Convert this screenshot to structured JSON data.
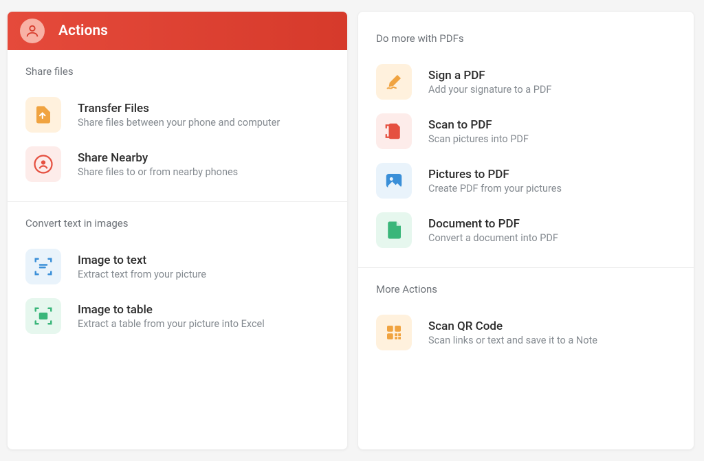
{
  "header": {
    "title": "Actions"
  },
  "left": {
    "section_share": {
      "label": "Share files",
      "items": [
        {
          "title": "Transfer Files",
          "desc": "Share files between your phone and computer"
        },
        {
          "title": "Share Nearby",
          "desc": "Share files to or from nearby phones"
        }
      ]
    },
    "section_convert": {
      "label": "Convert text in images",
      "items": [
        {
          "title": "Image to text",
          "desc": "Extract text from your picture"
        },
        {
          "title": "Image to table",
          "desc": "Extract a table from your picture into Excel"
        }
      ]
    }
  },
  "right": {
    "section_pdf": {
      "label": "Do more with PDFs",
      "items": [
        {
          "title": "Sign a PDF",
          "desc": "Add your signature to a PDF"
        },
        {
          "title": "Scan to PDF",
          "desc": "Scan pictures into PDF"
        },
        {
          "title": "Pictures to PDF",
          "desc": "Create PDF from your pictures"
        },
        {
          "title": "Document to PDF",
          "desc": "Convert a document into PDF"
        }
      ]
    },
    "section_more": {
      "label": "More Actions",
      "items": [
        {
          "title": "Scan QR Code",
          "desc": "Scan links or text and save it to a Note"
        }
      ]
    }
  }
}
